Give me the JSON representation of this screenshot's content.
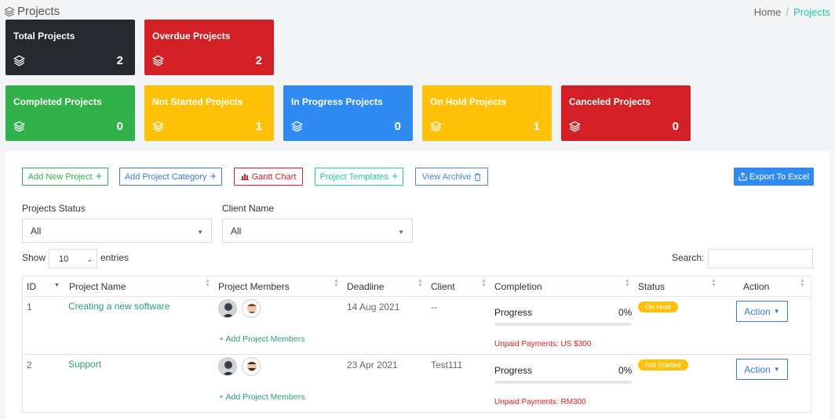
{
  "page": {
    "title": "Projects"
  },
  "breadcrumb": {
    "home": "Home",
    "separator": "/",
    "current": "Projects"
  },
  "cards": [
    {
      "title": "Total Projects",
      "count": "2",
      "color": "#262a2f"
    },
    {
      "title": "Overdue Projects",
      "count": "2",
      "color": "#d22026"
    },
    {
      "title": "Completed Projects",
      "count": "0",
      "color": "#30b14a"
    },
    {
      "title": "Not Started Projects",
      "count": "1",
      "color": "#ffc107"
    },
    {
      "title": "In Progress Projects",
      "count": "0",
      "color": "#2f8af2"
    },
    {
      "title": "On Hold Projects",
      "count": "1",
      "color": "#ffc107"
    },
    {
      "title": "Canceled Projects",
      "count": "0",
      "color": "#d22026"
    }
  ],
  "toolbar": {
    "add_project": "Add New Project",
    "add_category": "Add Project Category",
    "gantt": "Gantt Chart",
    "templates": "Project Templates",
    "archive": "View Archive",
    "export": "Export To Excel"
  },
  "filters": {
    "status_label": "Projects Status",
    "status_value": "All",
    "client_label": "Client Name",
    "client_value": "All"
  },
  "table_controls": {
    "show": "Show",
    "entries_value": "10",
    "entries": "entries",
    "search": "Search:"
  },
  "table": {
    "columns": [
      "ID",
      "Project Name",
      "Project Members",
      "Deadline",
      "Client",
      "Completion",
      "Status",
      "Action"
    ],
    "rows": [
      {
        "id": "1",
        "name": "Creating a new software",
        "add_members": "Add Project Members",
        "deadline": "14 Aug 2021",
        "client": "--",
        "progress_label": "Progress",
        "progress_pct": "0%",
        "progress_value": 0,
        "unpaid": "Unpaid Payments: US $300",
        "status": "On Hold",
        "action": "Action"
      },
      {
        "id": "2",
        "name": "Support",
        "add_members": "Add Project Members",
        "deadline": "23 Apr 2021",
        "client": "Test111",
        "progress_label": "Progress",
        "progress_pct": "0%",
        "progress_value": 0,
        "unpaid": "Unpaid Payments: RM300",
        "status": "Not Started",
        "action": "Action"
      }
    ]
  }
}
